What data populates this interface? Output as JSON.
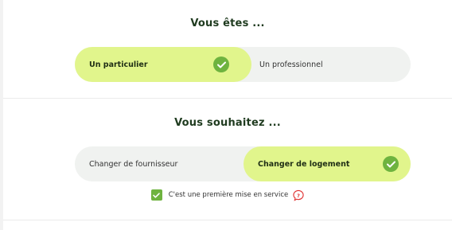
{
  "section1": {
    "title": "Vous êtes ...",
    "options": [
      {
        "label": "Un particulier",
        "selected": true
      },
      {
        "label": "Un professionnel",
        "selected": false
      }
    ]
  },
  "section2": {
    "title": "Vous souhaitez ...",
    "options": [
      {
        "label": "Changer de fournisseur",
        "selected": false
      },
      {
        "label": "Changer de logement",
        "selected": true
      }
    ],
    "checkbox": {
      "label": "C'est une première mise en service",
      "checked": true
    },
    "help_icon": "question-icon"
  },
  "colors": {
    "selected_bg": "#e1f58c",
    "unselected_bg": "#f0f2f0",
    "check_green": "#6eb33f",
    "title": "#1f3b1f",
    "help_red": "#e03030"
  }
}
